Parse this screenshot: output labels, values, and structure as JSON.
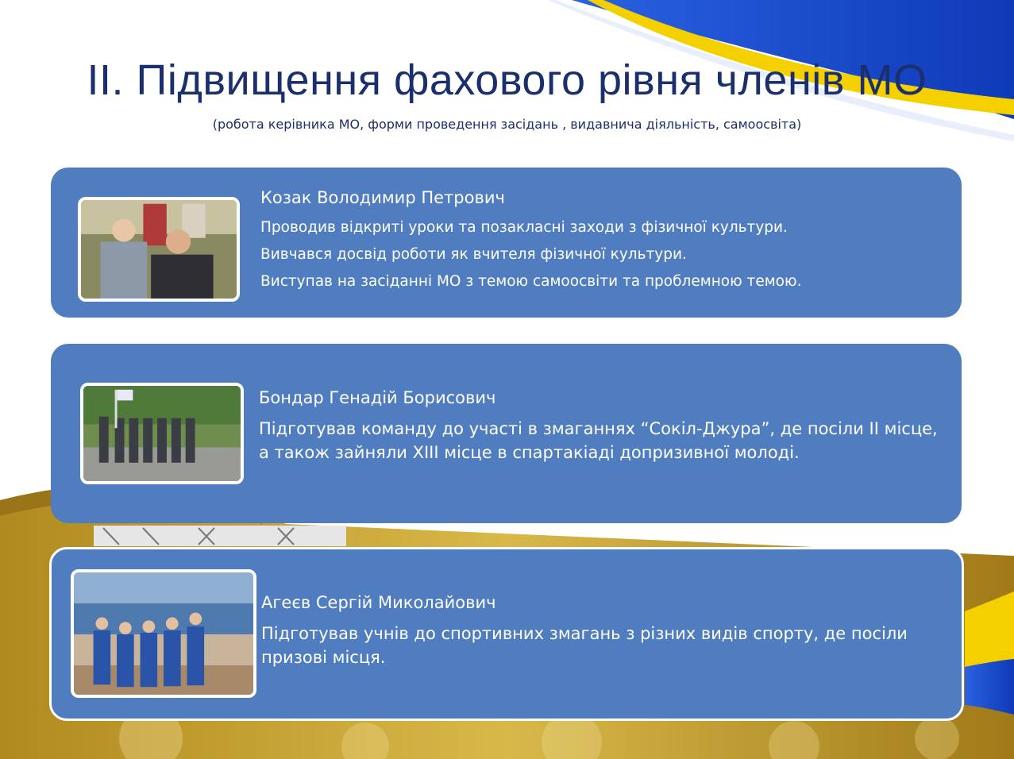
{
  "slide": {
    "title": "ІІ. Підвищення фахового рівня членів МО",
    "subtitle": "(робота керівника МО, форми проведення засідань , видавнича діяльність, самоосвіта)",
    "colors": {
      "title": "#1a2f6b",
      "card": "#4f7dbf",
      "card_text": "#ffffff",
      "accent_blue": "#1e4fd6",
      "accent_gold": "#c9a227",
      "accent_yellow": "#f4d000"
    }
  },
  "cards": [
    {
      "name": "Козак Володимир Петрович",
      "lines": [
        "Проводив відкриті уроки та позакласні заходи з фізичної культури.",
        "Вивчався досвід роботи як вчителя фізичної культури.",
        "Виступав на засіданні МО з темою самоосвіти та проблемною темою."
      ],
      "photo_icon": "portrait-photo"
    },
    {
      "name": "Бондар Генадій Борисович",
      "lines": [
        "Підготував команду до  участі в змаганнях “Сокіл-Джура”, де посіли ІІ місце, а також зайняли ХІІІ місце в спартакіаді допризивної молоді."
      ],
      "photo_icon": "team-outdoor-photo"
    },
    {
      "name": "Агеєв Сергій Миколайович",
      "lines": [
        "Підготував  учнів до спортивних змагань з різних видів спорту, де посіли призові місця."
      ],
      "photo_icon": "team-gym-photo"
    }
  ]
}
